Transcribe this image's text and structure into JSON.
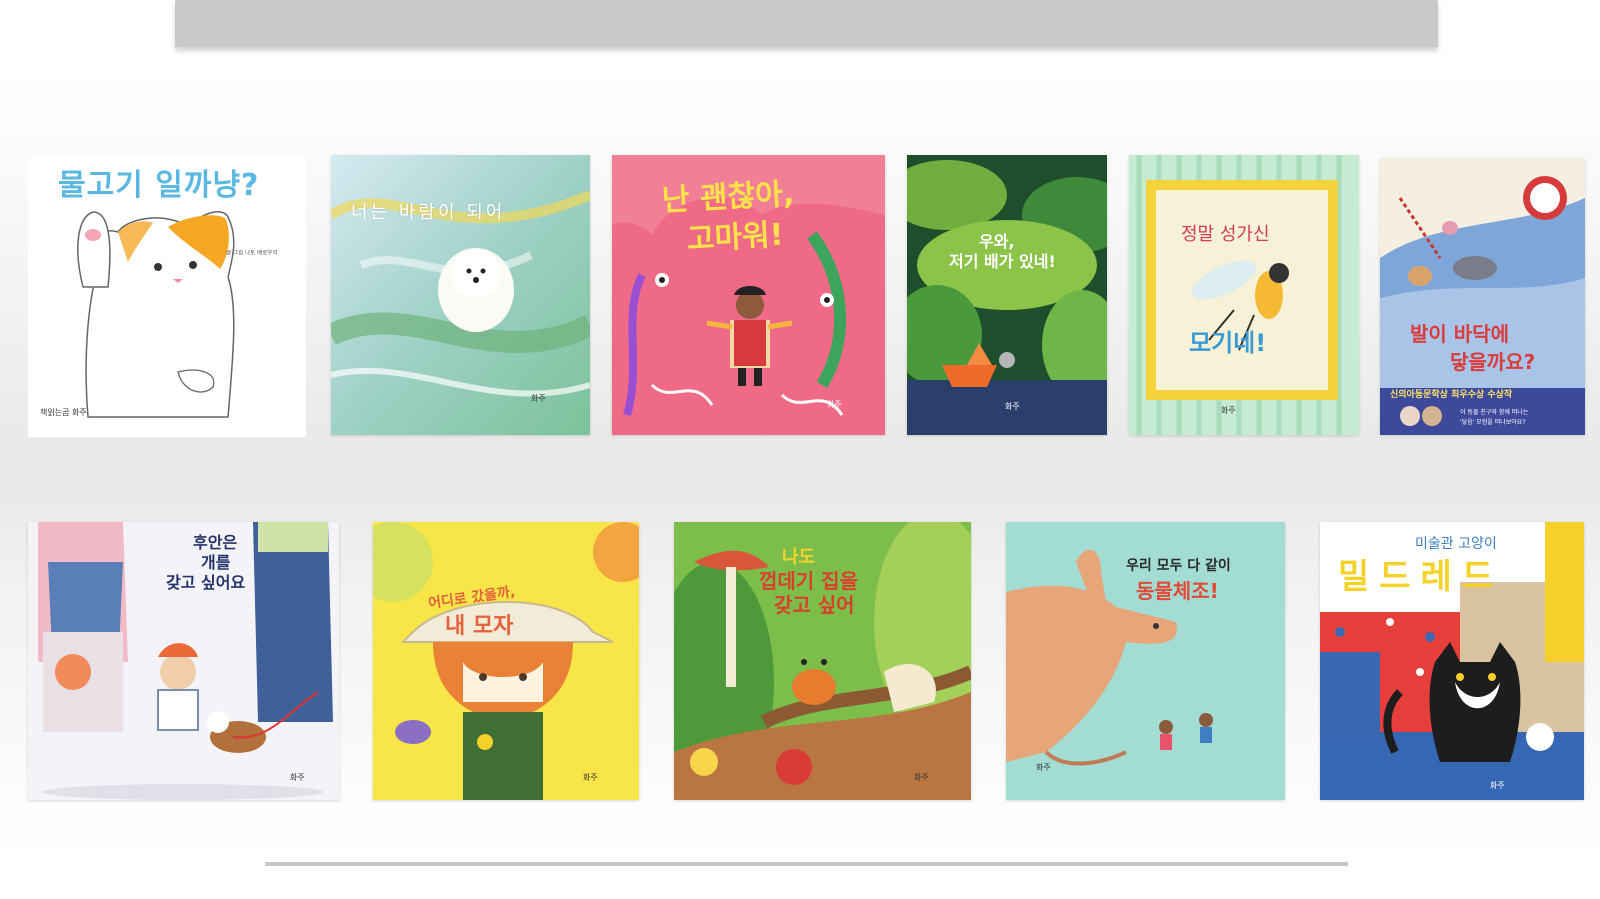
{
  "books": [
    {
      "title": "물고기 일까냥?",
      "author": "글·그림 나토 배로우리",
      "publisher": "책읽는곰 화주"
    },
    {
      "title": "너는 바람이 되어",
      "publisher": "화주"
    },
    {
      "title_line1": "난 괜찮아,",
      "title_line2": "고마워!",
      "publisher": "화주"
    },
    {
      "title_line1": "우와,",
      "title_line2": "저기 배가 있네!",
      "publisher": "화주"
    },
    {
      "title_line1": "정말 성가신",
      "title_line2": "모기네!",
      "publisher": "화주"
    },
    {
      "title_line1": "발이 바닥에",
      "title_line2": "닿을까요?",
      "award": "신의아동문학상 최우수상 수상작",
      "note_line1": "이 동물 친구와 함께 떠나는",
      "note_line2": "'닿음' 모험을 떠나보아요?"
    },
    {
      "title_line1": "후안은",
      "title_line2": "개를",
      "title_line3": "갖고 싶어요",
      "publisher": "화주"
    },
    {
      "title_line1": "어디로 갔을까,",
      "title_line2": "내 모자",
      "publisher": "화주"
    },
    {
      "title_line1": "나도",
      "title_line2": "껍데기 집을",
      "title_line3": "갖고 싶어",
      "publisher": "화주"
    },
    {
      "title_line1": "우리 모두 다 같이",
      "title_line2": "동물체조!",
      "publisher": "화주"
    },
    {
      "subtitle": "미술관 고양이",
      "title": "밀드레드",
      "publisher": "화주"
    }
  ]
}
